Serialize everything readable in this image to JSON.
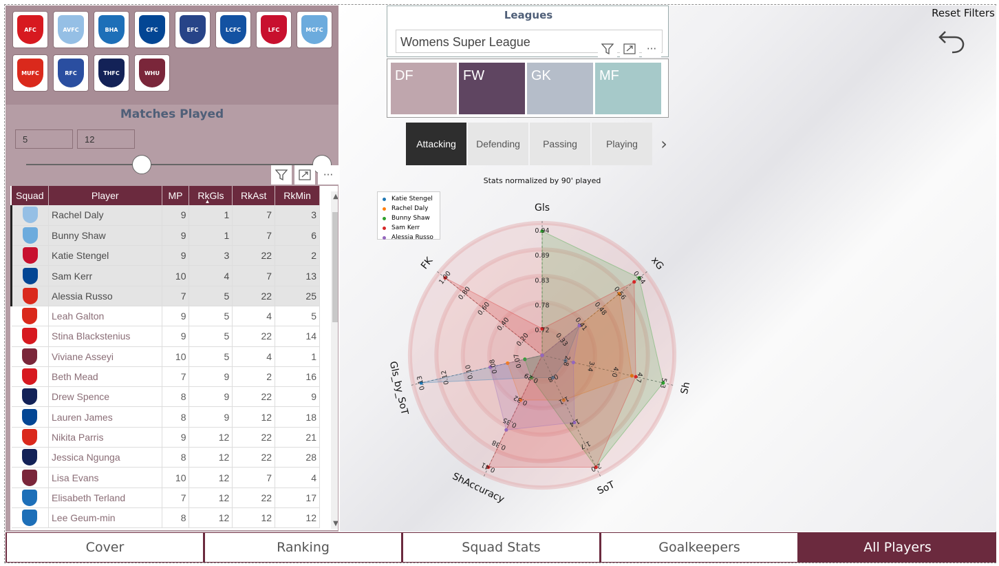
{
  "clubs": [
    {
      "name": "arsenal",
      "color": "#d71920",
      "abbr": "AFC"
    },
    {
      "name": "aston-villa",
      "color": "#95bfe5",
      "abbr": "AVFC"
    },
    {
      "name": "brighton",
      "color": "#1d6fb8",
      "abbr": "BHA"
    },
    {
      "name": "chelsea",
      "color": "#034694",
      "abbr": "CFC"
    },
    {
      "name": "everton",
      "color": "#274488",
      "abbr": "EFC"
    },
    {
      "name": "leicester",
      "color": "#1352a2",
      "abbr": "LCFC"
    },
    {
      "name": "liverpool",
      "color": "#c8102e",
      "abbr": "LFC"
    },
    {
      "name": "man-city",
      "color": "#6cabdd",
      "abbr": "MCFC"
    },
    {
      "name": "man-utd",
      "color": "#da291c",
      "abbr": "MUFC"
    },
    {
      "name": "reading",
      "color": "#2a4ea0",
      "abbr": "RFC"
    },
    {
      "name": "tottenham",
      "color": "#132257",
      "abbr": "THFC"
    },
    {
      "name": "west-ham",
      "color": "#7a263a",
      "abbr": "WHU"
    }
  ],
  "matches_played": {
    "title": "Matches Played",
    "min": "5",
    "max": "12"
  },
  "table": {
    "headers": [
      "Squad",
      "Player",
      "MP",
      "RkGls",
      "RkAst",
      "RkMin"
    ],
    "sort_indicator": "▲",
    "rows": [
      {
        "crest": "#95bfe5",
        "player": "Rachel Daly",
        "mp": "9",
        "rkgls": "1",
        "rkast": "7",
        "rkmin": "3",
        "selected": true
      },
      {
        "crest": "#6cabdd",
        "player": "Bunny Shaw",
        "mp": "9",
        "rkgls": "1",
        "rkast": "7",
        "rkmin": "6",
        "selected": true
      },
      {
        "crest": "#c8102e",
        "player": "Katie Stengel",
        "mp": "9",
        "rkgls": "3",
        "rkast": "22",
        "rkmin": "2",
        "selected": true
      },
      {
        "crest": "#034694",
        "player": "Sam Kerr",
        "mp": "10",
        "rkgls": "4",
        "rkast": "7",
        "rkmin": "13",
        "selected": true
      },
      {
        "crest": "#da291c",
        "player": "Alessia Russo",
        "mp": "7",
        "rkgls": "5",
        "rkast": "22",
        "rkmin": "25",
        "selected": true
      },
      {
        "crest": "#da291c",
        "player": "Leah Galton",
        "mp": "9",
        "rkgls": "5",
        "rkast": "4",
        "rkmin": "5",
        "selected": false
      },
      {
        "crest": "#d71920",
        "player": "Stina Blackstenius",
        "mp": "9",
        "rkgls": "5",
        "rkast": "22",
        "rkmin": "14",
        "selected": false
      },
      {
        "crest": "#7a263a",
        "player": "Viviane Asseyi",
        "mp": "10",
        "rkgls": "5",
        "rkast": "4",
        "rkmin": "1",
        "selected": false
      },
      {
        "crest": "#d71920",
        "player": "Beth Mead",
        "mp": "7",
        "rkgls": "9",
        "rkast": "2",
        "rkmin": "16",
        "selected": false
      },
      {
        "crest": "#132257",
        "player": "Drew Spence",
        "mp": "8",
        "rkgls": "9",
        "rkast": "22",
        "rkmin": "9",
        "selected": false
      },
      {
        "crest": "#034694",
        "player": "Lauren James",
        "mp": "8",
        "rkgls": "9",
        "rkast": "12",
        "rkmin": "18",
        "selected": false
      },
      {
        "crest": "#da291c",
        "player": "Nikita Parris",
        "mp": "9",
        "rkgls": "12",
        "rkast": "22",
        "rkmin": "21",
        "selected": false
      },
      {
        "crest": "#132257",
        "player": "Jessica Ngunga",
        "mp": "8",
        "rkgls": "12",
        "rkast": "22",
        "rkmin": "28",
        "selected": false
      },
      {
        "crest": "#7a263a",
        "player": "Lisa Evans",
        "mp": "10",
        "rkgls": "12",
        "rkast": "7",
        "rkmin": "4",
        "selected": false
      },
      {
        "crest": "#1d6fb8",
        "player": "Elisabeth Terland",
        "mp": "7",
        "rkgls": "12",
        "rkast": "22",
        "rkmin": "17",
        "selected": false
      },
      {
        "crest": "#1d6fb8",
        "player": "Lee Geum-min",
        "mp": "8",
        "rkgls": "12",
        "rkast": "12",
        "rkmin": "12",
        "selected": false
      }
    ]
  },
  "leagues": {
    "title": "Leagues",
    "selected": "Womens Super League"
  },
  "positions": [
    {
      "label": "DF",
      "color": "#bfa6ad"
    },
    {
      "label": "FW",
      "color": "#5f4561"
    },
    {
      "label": "GK",
      "color": "#b5bdc9"
    },
    {
      "label": "MF",
      "color": "#a6c9c9"
    }
  ],
  "stat_tabs": [
    "Attacking",
    "Defending",
    "Passing",
    "Playing"
  ],
  "reset_filters": "Reset Filters",
  "nav": [
    "Cover",
    "Ranking",
    "Squad Stats",
    "Goalkeepers",
    "All Players"
  ],
  "chart_data": {
    "type": "radar",
    "title": "Stats normalized by 90' played",
    "axes": [
      "Gls",
      "xG",
      "Sh",
      "SoT",
      "ShAccuracy",
      "Gls_by_SoT",
      "FK"
    ],
    "axis_ticks": {
      "Gls": [
        "0.72",
        "0.78",
        "0.83",
        "0.89",
        "0.94"
      ],
      "xG": [
        "0.33",
        "0.41",
        "0.48",
        "0.56",
        "0.64"
      ],
      "Sh": [
        "2.8",
        "3.4",
        "4.0",
        "4.7",
        "5.3"
      ],
      "SoT": [
        "0.8",
        "1.1",
        "1.4",
        "1.7",
        "2.0"
      ],
      "ShAccuracy": [
        "0.29",
        "0.32",
        "0.35",
        "0.38",
        "0.41"
      ],
      "Gls_by_SoT": [
        "0.07",
        "0.08",
        "0.10",
        "0.12",
        "0.13"
      ],
      "FK": [
        "0.20",
        "0.40",
        "0.60",
        "0.80",
        "1.00"
      ]
    },
    "series": [
      {
        "name": "Katie Stengel",
        "color": "#1f77b4",
        "values": [
          0.66,
          0.4,
          2.8,
          0.8,
          0.29,
          0.13,
          0.0
        ]
      },
      {
        "name": "Rachel Daly",
        "color": "#ff7f0e",
        "values": [
          0.66,
          0.56,
          4.5,
          1.1,
          0.32,
          0.08,
          0.0
        ]
      },
      {
        "name": "Bunny Shaw",
        "color": "#2ca02c",
        "values": [
          0.94,
          0.64,
          5.3,
          2.0,
          0.29,
          0.07,
          0.0
        ]
      },
      {
        "name": "Sam Kerr",
        "color": "#d62728",
        "values": [
          0.72,
          0.62,
          4.6,
          2.0,
          0.41,
          0.06,
          1.0
        ]
      },
      {
        "name": "Alessia Russo",
        "color": "#9467bd",
        "values": [
          0.66,
          0.4,
          3.0,
          1.4,
          0.36,
          0.09,
          0.0
        ]
      }
    ]
  }
}
